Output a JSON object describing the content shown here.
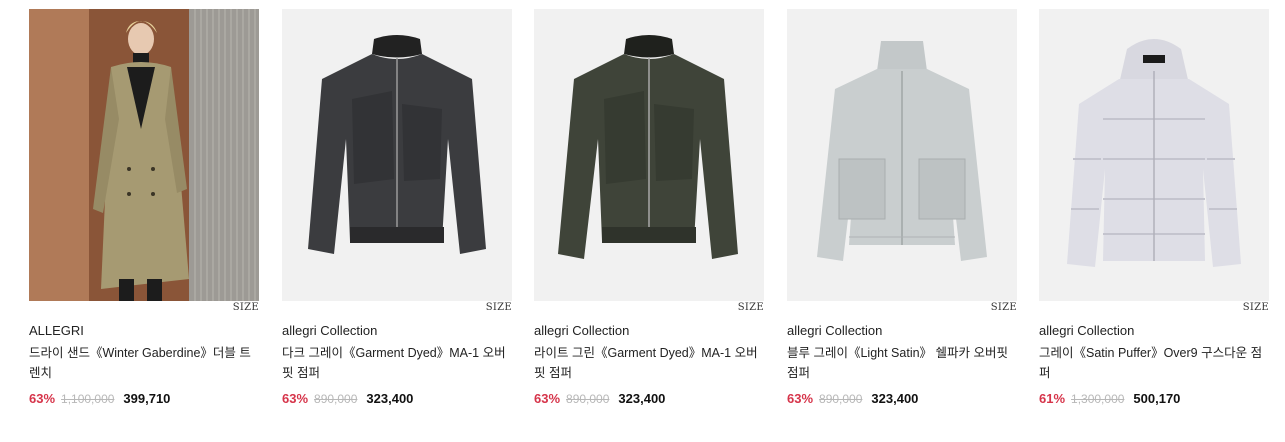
{
  "products": [
    {
      "brand": "ALLEGRI",
      "name": "드라이 샌드《Winter Gaberdine》더블 트렌치",
      "discount": "63%",
      "original_price": "1,100,000",
      "sale_price": "399,710",
      "size_label": "SIZE",
      "image": "beige-double-trench-coat-on-model"
    },
    {
      "brand": "allegri Collection",
      "name": "다크 그레이《Garment Dyed》MA-1 오버핏 점퍼",
      "discount": "63%",
      "original_price": "890,000",
      "sale_price": "323,400",
      "size_label": "SIZE",
      "image": "dark-gray-ma1-jacket"
    },
    {
      "brand": "allegri Collection",
      "name": "라이트 그린《Garment Dyed》MA-1 오버핏 점퍼",
      "discount": "63%",
      "original_price": "890,000",
      "sale_price": "323,400",
      "size_label": "SIZE",
      "image": "dark-green-ma1-jacket"
    },
    {
      "brand": "allegri Collection",
      "name": "블루 그레이《Light Satin》 쉘파카 오버핏 점퍼",
      "discount": "63%",
      "original_price": "890,000",
      "sale_price": "323,400",
      "size_label": "SIZE",
      "image": "light-blue-gray-parka"
    },
    {
      "brand": "allegri Collection",
      "name": "그레이《Satin Puffer》Over9 구스다운 점퍼",
      "discount": "61%",
      "original_price": "1,300,000",
      "sale_price": "500,170",
      "size_label": "SIZE",
      "image": "light-gray-puffer-down-jacket"
    }
  ],
  "colors": {
    "discount": "#d6344a",
    "strike": "#b8b8b8",
    "text": "#222222"
  }
}
